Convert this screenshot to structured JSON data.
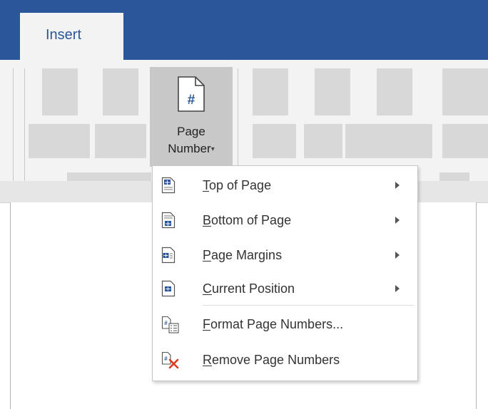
{
  "tabs": {
    "insert_label": "Insert"
  },
  "ribbon": {
    "page_number_button": {
      "line1": "Page",
      "line2": "Number",
      "caret": "▾",
      "icon_glyph": "#"
    }
  },
  "menu": {
    "items": [
      {
        "accel": "T",
        "rest": "op of Page",
        "icon": "top-of-page-icon",
        "has_submenu": true
      },
      {
        "accel": "B",
        "rest": "ottom of Page",
        "icon": "bottom-of-page-icon",
        "has_submenu": true
      },
      {
        "accel": "P",
        "rest": "age Margins",
        "icon": "page-margins-icon",
        "has_submenu": true
      },
      {
        "accel": "C",
        "rest": "urrent Position",
        "icon": "current-position-icon",
        "has_submenu": true
      },
      {
        "accel": "F",
        "rest": "ormat Page Numbers...",
        "icon": "format-page-numbers-icon",
        "has_submenu": false
      },
      {
        "accel": "R",
        "rest": "emove Page Numbers",
        "icon": "remove-page-numbers-icon",
        "has_submenu": false
      }
    ]
  },
  "colors": {
    "tabbar": "#2b579a",
    "ribbon": "#f3f3f3",
    "selected_button": "#c8c8c8",
    "icon_accent": "#2b579a",
    "remove_red": "#e03a1e"
  }
}
